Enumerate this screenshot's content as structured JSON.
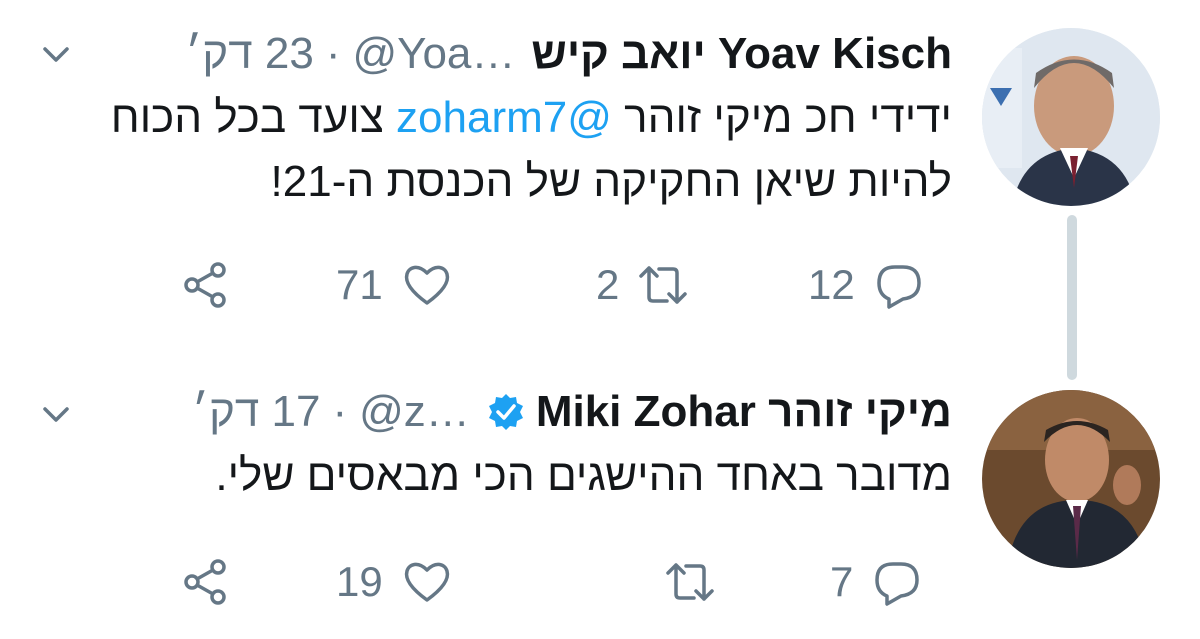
{
  "tweets": [
    {
      "author_name": "Yoav Kisch יואב קיש",
      "handle": "@Yoa…",
      "separator": "·",
      "time": "23 דק׳",
      "verified": false,
      "text_before": "ידידי חכ מיקי זוהר ",
      "mention": "@zoharm7",
      "text_after": " צועד בכל הכוח להיות שיאן החקיקה של הכנסת ה-21!",
      "counts": {
        "reply": "12",
        "retweet": "2",
        "like": "71"
      }
    },
    {
      "author_name": "מיקי זוהר Miki Zohar",
      "handle": "@z…",
      "separator": "·",
      "time": "17 דק׳",
      "verified": true,
      "text_before": "מדובר באחד ההישגים הכי מבאסים שלי.",
      "mention": "",
      "text_after": "",
      "counts": {
        "reply": "7",
        "retweet": "",
        "like": "19"
      }
    }
  ],
  "icons": {
    "reply": "reply-icon",
    "retweet": "retweet-icon",
    "like": "heart-icon",
    "share": "share-icon",
    "caret": "chevron-down-icon",
    "verified": "verified-badge-icon"
  },
  "colors": {
    "text": "#14171a",
    "secondary": "#657786",
    "link": "#1da1f2",
    "thread_line": "#cfd9de"
  }
}
